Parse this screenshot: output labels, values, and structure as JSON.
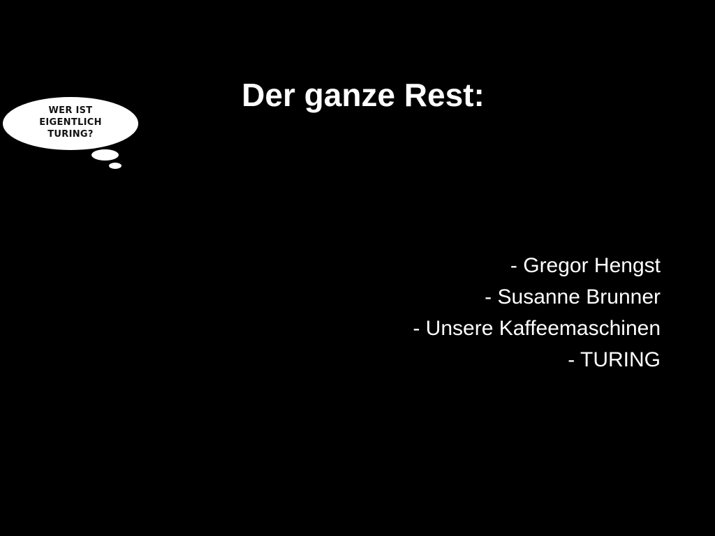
{
  "slide": {
    "title": "Der ganze Rest:",
    "thought_bubble": {
      "lines": [
        "WER IST",
        "EIGENTLICH",
        "TURING?"
      ]
    },
    "items": [
      "- Gregor Hengst",
      "- Susanne Brunner",
      "- Unsere Kaffeemaschinen",
      "- TURING"
    ],
    "colors": {
      "background": "#000000",
      "text": "#ffffff",
      "bubble": "#ffffff",
      "bubble_text": "#111111"
    }
  }
}
